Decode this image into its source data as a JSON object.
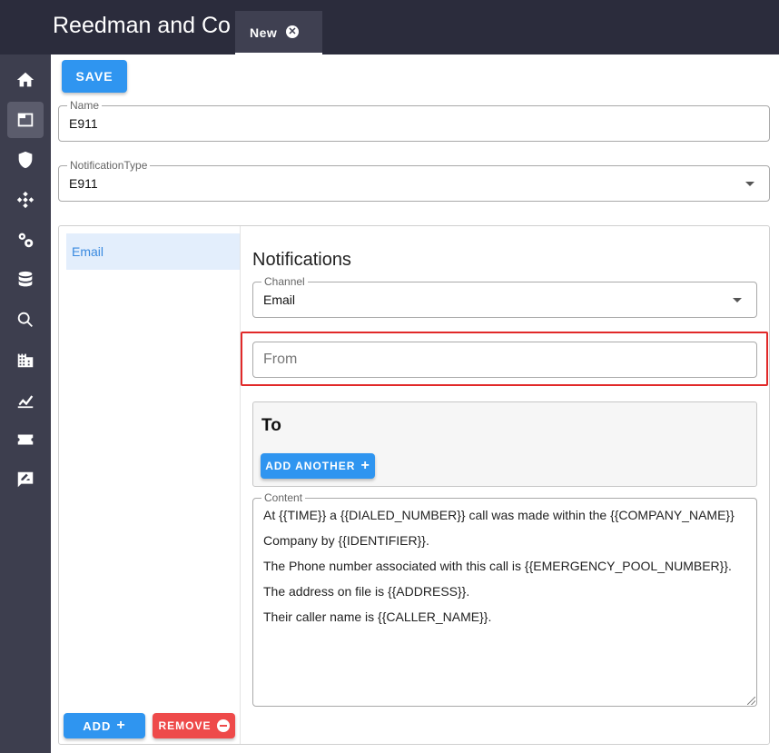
{
  "app": {
    "title": "Reedman and Co"
  },
  "tabs": [
    {
      "label": "New",
      "close_icon": "close-icon"
    }
  ],
  "sidebar": {
    "items": [
      {
        "name": "home",
        "icon": "home-icon",
        "active": false
      },
      {
        "name": "window",
        "icon": "window-icon",
        "active": true
      },
      {
        "name": "shield",
        "icon": "shield-icon",
        "active": false
      },
      {
        "name": "network",
        "icon": "network-icon",
        "active": false
      },
      {
        "name": "settings",
        "icon": "gears-icon",
        "active": false
      },
      {
        "name": "database",
        "icon": "database-icon",
        "active": false
      },
      {
        "name": "search",
        "icon": "search-icon",
        "active": false
      },
      {
        "name": "building",
        "icon": "building-icon",
        "active": false
      },
      {
        "name": "analytics",
        "icon": "chart-icon",
        "active": false
      },
      {
        "name": "ticket",
        "icon": "ticket-icon",
        "active": false
      },
      {
        "name": "feedback",
        "icon": "feedback-icon",
        "active": false
      }
    ]
  },
  "toolbar": {
    "save_label": "SAVE"
  },
  "form": {
    "name": {
      "label": "Name",
      "value": "E911"
    },
    "notification_type": {
      "label": "NotificationType",
      "value": "E911"
    }
  },
  "list": {
    "items": [
      {
        "label": "Email",
        "selected": true
      }
    ],
    "add_label": "ADD",
    "remove_label": "REMOVE"
  },
  "notifications": {
    "title": "Notifications",
    "channel": {
      "label": "Channel",
      "value": "Email"
    },
    "from": {
      "placeholder": "From",
      "value": ""
    },
    "to": {
      "title": "To",
      "add_another_label": "ADD ANOTHER"
    },
    "content": {
      "label": "Content",
      "lines": [
        "At {{TIME}} a {{DIALED_NUMBER}} call was made within the {{COMPANY_NAME}}",
        "Company by {{IDENTIFIER}}.",
        "The Phone number associated with this call is {{EMERGENCY_POOL_NUMBER}}.",
        "The address on file is {{ADDRESS}}.",
        "Their caller name is {{CALLER_NAME}}."
      ]
    }
  },
  "colors": {
    "topbar": "#2b2c3c",
    "sidebar": "#3d3e4e",
    "primary": "#2f95f0",
    "danger": "#ee4a4a",
    "highlight": "#e12929"
  }
}
